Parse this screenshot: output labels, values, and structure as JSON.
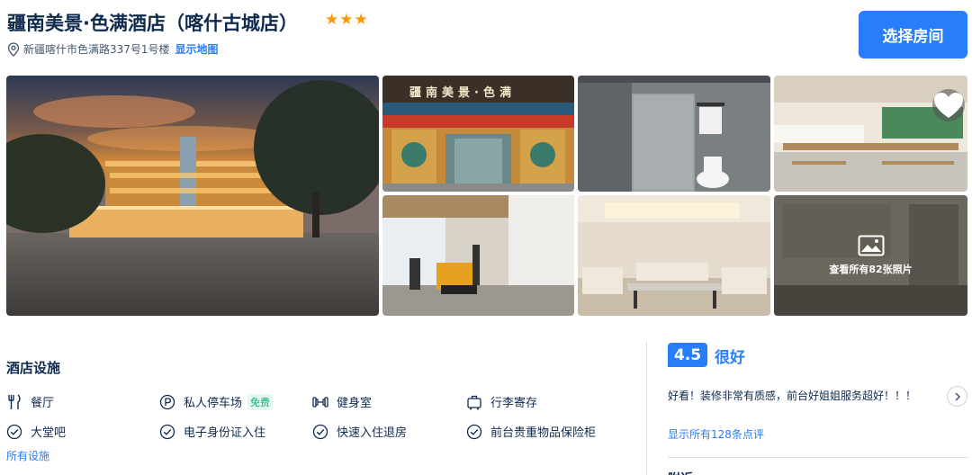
{
  "hotel": {
    "name": "疆南美景·色满酒店（喀什古城店）",
    "star_count": 3,
    "address": "新疆喀什市色满路337号1号楼",
    "map_link": "显示地图"
  },
  "header": {
    "select_room_label": "选择房间"
  },
  "gallery": {
    "storefront_sign": "疆南美景·色满",
    "facade_sign": "疆南美景·色满",
    "view_all_label": "查看所有82张照片"
  },
  "facilities": {
    "title": "酒店设施",
    "items": [
      {
        "label": "餐厅",
        "icon": "utensils-icon"
      },
      {
        "label": "私人停车场",
        "icon": "parking-icon",
        "tag": "免费"
      },
      {
        "label": "健身室",
        "icon": "dumbbell-icon"
      },
      {
        "label": "行李寄存",
        "icon": "luggage-icon"
      },
      {
        "label": "大堂吧",
        "icon": "check-circle-icon"
      },
      {
        "label": "电子身份证入住",
        "icon": "check-circle-icon"
      },
      {
        "label": "快速入住退房",
        "icon": "check-circle-icon"
      },
      {
        "label": "前台贵重物品保险柜",
        "icon": "check-circle-icon"
      }
    ],
    "all_link": "所有设施"
  },
  "reviews": {
    "score": "4.5",
    "score_text": "很好",
    "snippet": "好看！装修非常有质感，前台好姐姐服务超好！！！",
    "all_link": "显示所有128条点评",
    "next_section_heading": "附近"
  },
  "colors": {
    "accent": "#287dfa",
    "star": "#ff9500",
    "free": "#06ae72",
    "text": "#0f294d"
  }
}
